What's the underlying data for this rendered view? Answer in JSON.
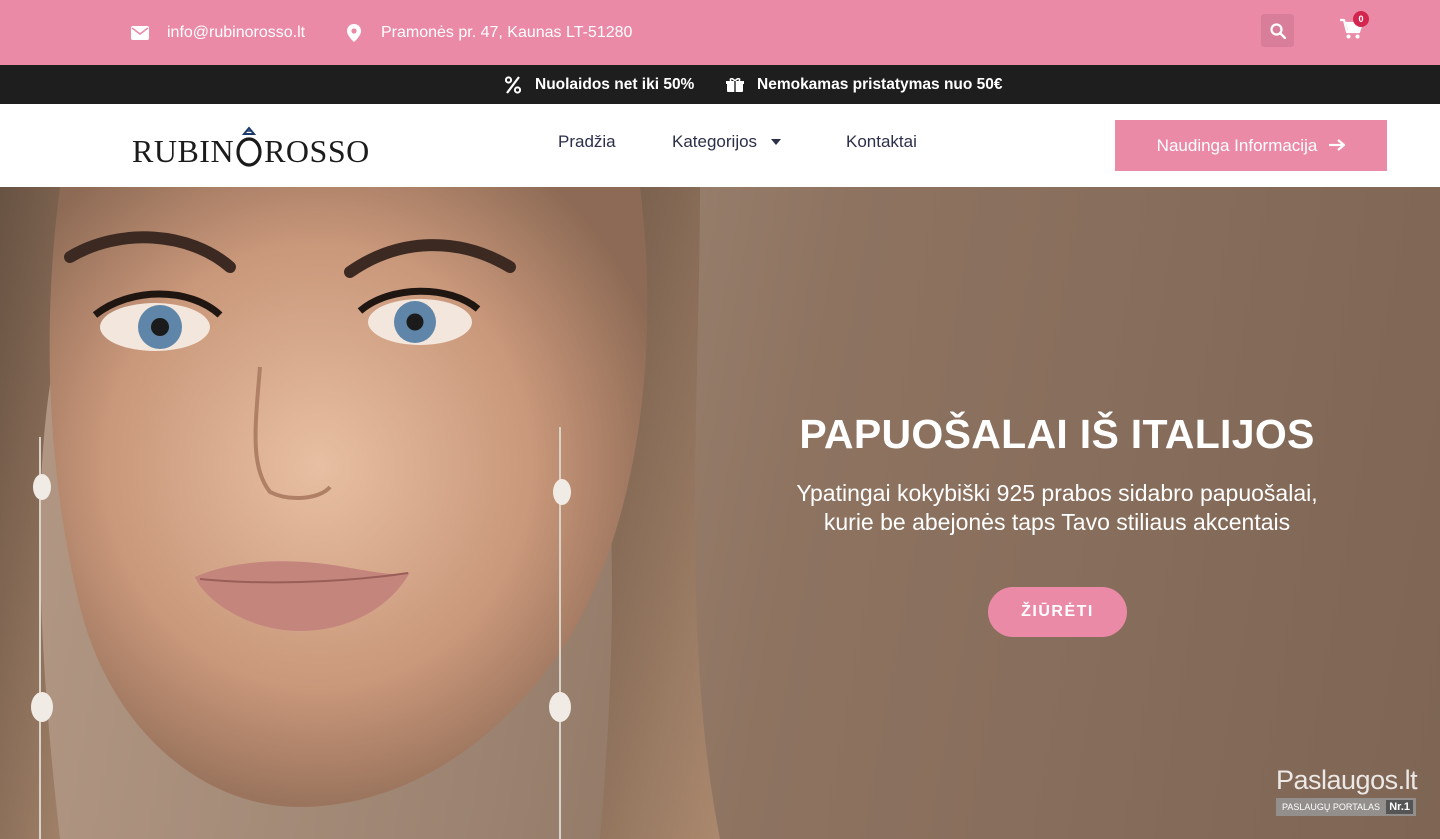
{
  "topbar": {
    "email": "info@rubinorosso.lt",
    "address": "Pramonės pr. 47, Kaunas LT-51280",
    "cart_count": "0",
    "icons": {
      "email": "envelope-icon",
      "address": "map-pin-icon",
      "search": "search-icon",
      "cart": "cart-icon"
    }
  },
  "promo": {
    "discount": "Nuolaidos net iki 50%",
    "delivery": "Nemokamas pristatymas nuo 50€"
  },
  "header": {
    "logo_left": "RUBIN",
    "logo_right": "ROSSO",
    "nav": [
      {
        "label": "Pradžia"
      },
      {
        "label": "Kategorijos"
      },
      {
        "label": "Kontaktai"
      }
    ],
    "info_button": "Naudinga Informacija"
  },
  "hero": {
    "title": "PAPUOŠALAI IŠ ITALIJOS",
    "subtitle_line1": "Ypatingai kokybiški 925 prabos sidabro papuošalai,",
    "subtitle_line2": "kurie be abejonės taps Tavo stiliaus akcentais",
    "button": "ŽIŪRĖTI"
  },
  "watermark": {
    "title": "Paslaugos.lt",
    "subtitle": "PASLAUGŲ PORTALAS",
    "badge": "Nr.1"
  },
  "colors": {
    "pink": "#ea8aa7",
    "dark": "#1e1e1e",
    "nav_text": "#2b2f4a"
  }
}
